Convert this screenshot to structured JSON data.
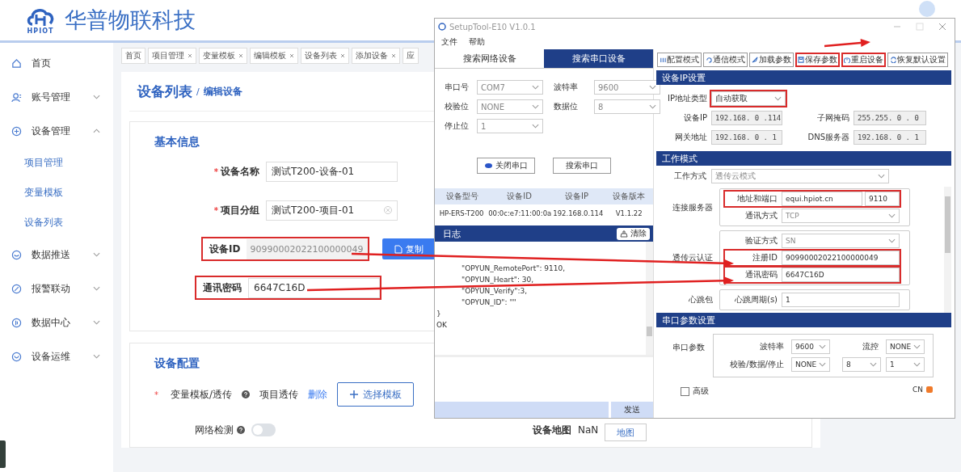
{
  "header": {
    "logo_text": "HPIOT",
    "brand": "华普物联科技"
  },
  "sidebar": {
    "items": [
      {
        "label": "首页",
        "kind": "link"
      },
      {
        "label": "账号管理",
        "kind": "group",
        "expanded": false
      },
      {
        "label": "设备管理",
        "kind": "group",
        "expanded": true,
        "children": [
          {
            "label": "项目管理"
          },
          {
            "label": "变量模板"
          },
          {
            "label": "设备列表"
          }
        ]
      },
      {
        "label": "数据推送",
        "kind": "group",
        "expanded": false
      },
      {
        "label": "报警联动",
        "kind": "group",
        "expanded": false
      },
      {
        "label": "数据中心",
        "kind": "group",
        "expanded": false
      },
      {
        "label": "设备运维",
        "kind": "group",
        "expanded": false
      }
    ]
  },
  "tabs": [
    {
      "label": "首页",
      "closable": false
    },
    {
      "label": "项目管理",
      "closable": true
    },
    {
      "label": "变量模板",
      "closable": true
    },
    {
      "label": "编辑模板",
      "closable": true
    },
    {
      "label": "设备列表",
      "closable": true
    },
    {
      "label": "添加设备",
      "closable": true
    },
    {
      "label": "应",
      "closable": false
    }
  ],
  "breadcrumb": {
    "parent": "设备列表",
    "separator": "/",
    "current": "编辑设备"
  },
  "basic_info": {
    "title": "基本信息",
    "copy_button": "复制",
    "fields": [
      {
        "label": "设备名称",
        "required_mark": "*",
        "value": "测试T200-设备-01",
        "disabled": false,
        "clearable": false,
        "highlighted": false
      },
      {
        "label": "项目分组",
        "required_mark": "*",
        "value": "测试T200-项目-01",
        "disabled": false,
        "clearable": true,
        "highlighted": false
      },
      {
        "label": "设备ID",
        "value": "90990002022100000049",
        "disabled": true,
        "clearable": false,
        "highlighted": true
      },
      {
        "label": "通讯密码",
        "value": "6647C16D",
        "disabled": false,
        "clearable": false,
        "highlighted": true
      }
    ]
  },
  "device_config": {
    "title": "设备配置",
    "template": {
      "label": "变量模板/透传",
      "required_mark": "*",
      "value": "项目透传",
      "delete": "删除",
      "select": "选择模板"
    },
    "network_check": {
      "label": "网络检测",
      "on": false
    },
    "map": {
      "label": "设备地图",
      "value": "NaN",
      "button": "地图"
    }
  },
  "tool": {
    "title": "SetupTool-E10 V1.0.1",
    "menu": [
      "文件",
      "帮助"
    ],
    "tabs": [
      {
        "label": "搜索网络设备",
        "selected": false
      },
      {
        "label": "搜索串口设备",
        "selected": true
      }
    ],
    "serial_fields": [
      {
        "label": "串口号",
        "value": "COM7"
      },
      {
        "label": "波特率",
        "value": "9600"
      },
      {
        "label": "校验位",
        "value": "NONE"
      },
      {
        "label": "数据位",
        "value": "8"
      },
      {
        "label": "停止位",
        "value": "1"
      }
    ],
    "buttons": [
      {
        "label": "关闭串口",
        "kind": "port"
      },
      {
        "label": "搜索串口",
        "kind": "plain"
      }
    ],
    "device_table": {
      "columns": [
        "设备型号",
        "设备ID",
        "设备IP",
        "设备版本"
      ],
      "rows": [
        [
          "HP-ERS-T200",
          "00:0c:e7:11:00:0a",
          "192.168.0.114",
          "V1.1.22"
        ]
      ]
    },
    "log": {
      "title": "日志",
      "clear": "清除",
      "send": "发送",
      "lines": [
        {
          "text": "\"OPYUN_RemotePort\":   9110,",
          "indent": true
        },
        {
          "text": "\"OPYUN_Heart\": 30,",
          "indent": true
        },
        {
          "text": "\"OPYUN_Verify\":3,",
          "indent": true
        },
        {
          "text": "\"OPYUN_ID\":     \"\"",
          "indent": true
        },
        {
          "text": "}",
          "indent": false
        },
        {
          "text": "OK",
          "indent": false
        }
      ]
    },
    "toolbar": [
      {
        "label": "配置模式",
        "highlighted": false
      },
      {
        "label": "通信模式",
        "highlighted": false
      },
      {
        "label": "加载参数",
        "highlighted": false
      },
      {
        "label": "保存参数",
        "highlighted": true
      },
      {
        "label": "重启设备",
        "highlighted": true
      },
      {
        "label": "恢复默认设置",
        "highlighted": false
      }
    ],
    "ip_section": {
      "title": "设备IP设置",
      "ip_type": {
        "label": "IP地址类型",
        "value": "自动获取",
        "highlighted": true
      },
      "fields": [
        {
          "label": "设备IP",
          "value": "192.168. 0 .114"
        },
        {
          "label": "子网掩码",
          "value": "255.255. 0 . 0"
        },
        {
          "label": "网关地址",
          "value": "192.168. 0 . 1"
        },
        {
          "label": "DNS服务器",
          "value": "192.168. 0 . 1"
        }
      ]
    },
    "work_section": {
      "title": "工作模式",
      "mode": {
        "label": "工作方式",
        "value": "透传云模式"
      },
      "groups": [
        {
          "label": "连接服务器",
          "rows": [
            {
              "kind": "address",
              "label": "地址和端口",
              "value": "equi.hpiot.cn",
              "port": "9110",
              "highlighted": true
            },
            {
              "kind": "select",
              "label": "通讯方式",
              "value": "TCP",
              "highlighted": false
            }
          ]
        },
        {
          "label": "透传云认证",
          "rows": [
            {
              "kind": "select",
              "label": "验证方式",
              "value": "SN",
              "highlighted": false
            },
            {
              "kind": "text",
              "label": "注册ID",
              "value": "90990002022100000049",
              "highlighted": true
            },
            {
              "kind": "text",
              "label": "通讯密码",
              "value": "6647C16D",
              "highlighted": true
            }
          ]
        },
        {
          "label": "心跳包",
          "rows": [
            {
              "kind": "text",
              "label": "心跳周期(s)",
              "value": "1",
              "highlighted": false
            }
          ]
        }
      ]
    },
    "serial_section": {
      "title": "串口参数设置",
      "label": "串口参数",
      "rows": [
        {
          "label": "波特率",
          "values": [
            "9600"
          ],
          "extra_label": "流控",
          "extra_value": "NONE"
        },
        {
          "label": "校验/数据/停止",
          "values": [
            "NONE",
            "8",
            "1"
          ]
        }
      ]
    },
    "advanced": {
      "label": "高级",
      "checked": false
    },
    "ime": {
      "label": "CN"
    }
  }
}
